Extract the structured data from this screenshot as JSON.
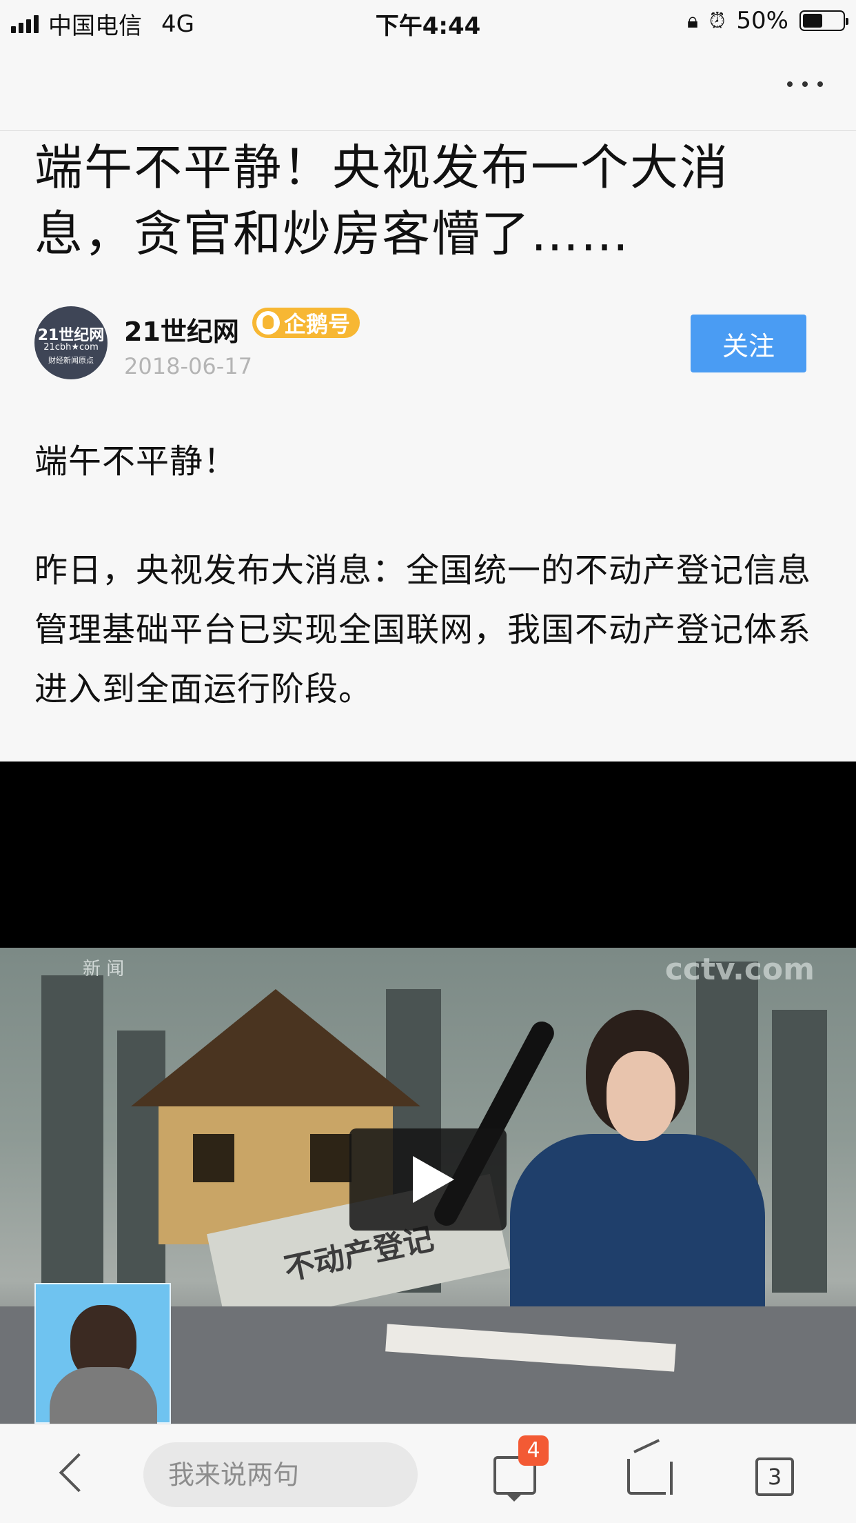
{
  "status_bar": {
    "carrier": "中国电信",
    "network": "4G",
    "time": "下午4:44",
    "battery": "50%",
    "battery_level": 0.5
  },
  "article": {
    "title": "端午不平静！央视发布一个大消息，贪官和炒房客懵了……",
    "author": {
      "name": "21世纪网",
      "badge": "企鹅号",
      "date": "2018-06-17",
      "avatar_text_1": "21世纪网",
      "avatar_text_2": "21cbh★com",
      "avatar_text_3": "财经新闻原点"
    },
    "follow_label": "关注",
    "paragraphs": [
      "端午不平静！",
      "昨日，央视发布大消息：全国统一的不动产登记信息管理基础平台已实现全国联网，我国不动产登记体系进入到全面运行阶段。"
    ]
  },
  "video": {
    "watermark": "cctv.com",
    "channel_label": "新 闻",
    "paper_text": "不动产登记"
  },
  "toolbar": {
    "comment_placeholder": "我来说两句",
    "comment_count": "4",
    "tab_count": "3"
  },
  "icons": [
    "signal-icon",
    "orientation-lock-icon",
    "alarm-icon",
    "battery-icon",
    "more-icon",
    "back-icon",
    "comment-icon",
    "share-icon",
    "tabs-icon",
    "play-icon"
  ]
}
